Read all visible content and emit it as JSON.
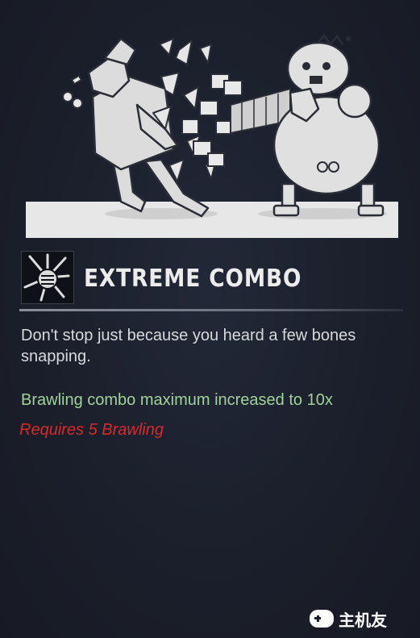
{
  "perk": {
    "title": "EXTREME COMBO",
    "description": "Don't stop just because you heard a few bones snapping.",
    "effect": "Brawling combo maximum increased to 10x",
    "requirement": "Requires 5 Brawling",
    "icon": "fist-impact-icon",
    "illustration": "perk-illustration"
  },
  "watermark": {
    "text": "主机友",
    "icon": "gamepad-icon"
  },
  "colors": {
    "background": "#1b1f2b",
    "title": "#ececec",
    "description": "#d8d9dd",
    "effect": "#9fd39a",
    "requirement": "#d92a2a"
  }
}
